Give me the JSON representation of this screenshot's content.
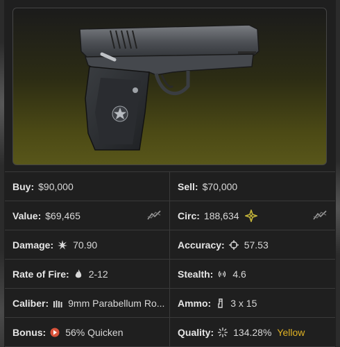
{
  "item": {
    "image": "pistol-image"
  },
  "stats": {
    "buy": {
      "label": "Buy:",
      "value": "$90,000"
    },
    "sell": {
      "label": "Sell:",
      "value": "$70,000"
    },
    "value": {
      "label": "Value:",
      "value": "$69,465",
      "icon": "trend-chart-icon"
    },
    "circ": {
      "label": "Circ:",
      "value": "188,634",
      "icon": "circulation-icon",
      "trend_icon": "trend-chart-icon"
    },
    "damage": {
      "label": "Damage:",
      "value": "70.90",
      "icon": "explosion-icon"
    },
    "accuracy": {
      "label": "Accuracy:",
      "value": "57.53",
      "icon": "crosshair-icon"
    },
    "rof": {
      "label": "Rate of Fire:",
      "value": "2-12",
      "icon": "flame-icon"
    },
    "stealth": {
      "label": "Stealth:",
      "value": "4.6",
      "icon": "sound-waves-icon"
    },
    "caliber": {
      "label": "Caliber:",
      "value": "9mm Parabellum Ro...",
      "icon": "bullets-icon"
    },
    "ammo": {
      "label": "Ammo:",
      "value": "3 x 15",
      "icon": "magazine-icon"
    },
    "bonus": {
      "label": "Bonus:",
      "value": "56% Quicken",
      "icon": "quicken-icon"
    },
    "quality": {
      "label": "Quality:",
      "value": "134.28%",
      "tier": "Yellow",
      "icon": "sparkle-icon"
    }
  },
  "colors": {
    "quality_tier": "#e0b224",
    "circ_icon": "#c8b83a",
    "bonus_icon": "#d9533b"
  }
}
